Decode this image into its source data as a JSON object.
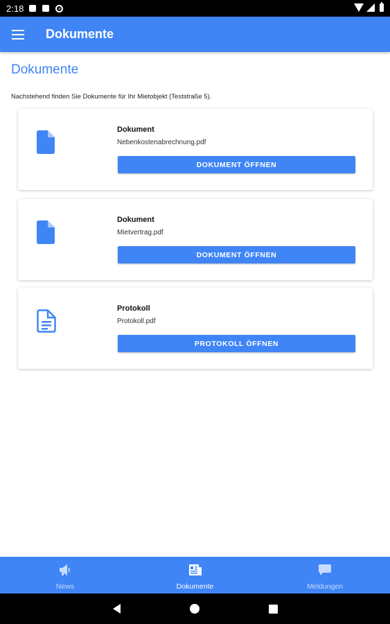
{
  "status_bar": {
    "time": "2:18",
    "icons": [
      "notification-icon",
      "sd-card-icon",
      "data-saver-icon",
      "wifi-icon",
      "signal-icon",
      "battery-icon"
    ]
  },
  "app_bar": {
    "title": "Dokumente",
    "menu_icon": "menu-icon"
  },
  "main": {
    "heading": "Dokumente",
    "intro": "Nachstehend finden Sie Dokumente für Ihr Mietobjekt (Teststraße 5).",
    "cards": [
      {
        "title": "Dokument",
        "filename": "Nebenkostenabrechnung.pdf",
        "button_label": "DOKUMENT ÖFFNEN",
        "icon": "file-icon"
      },
      {
        "title": "Dokument",
        "filename": "Mietvertrag.pdf",
        "button_label": "DOKUMENT ÖFFNEN",
        "icon": "file-icon"
      },
      {
        "title": "Protokoll",
        "filename": "Protokoll.pdf",
        "button_label": "PROTOKOLL ÖFFNEN",
        "icon": "file-text-outline-icon"
      }
    ]
  },
  "bottom_nav": {
    "items": [
      {
        "label": "News",
        "icon": "megaphone-icon",
        "active": false
      },
      {
        "label": "Dokumente",
        "icon": "newspaper-icon",
        "active": true
      },
      {
        "label": "Meldungen",
        "icon": "chat-bubble-icon",
        "active": false
      }
    ]
  },
  "colors": {
    "primary": "#3f85f5",
    "inactive_nav": "#c7dcff",
    "background": "#ffffff"
  }
}
